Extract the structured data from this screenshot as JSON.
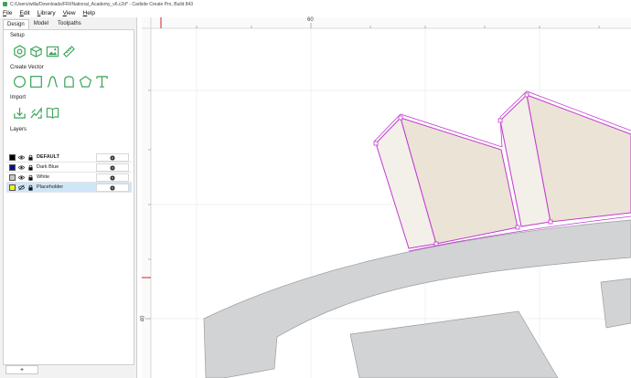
{
  "window": {
    "title": "C:/Users/willa/Downloads/FRI/National_Academy_v6.c2d* - Carbide Create Pro, Build 843"
  },
  "menu": {
    "items": [
      "File",
      "Edit",
      "Library",
      "View",
      "Help"
    ]
  },
  "tabs": [
    "Design",
    "Model",
    "Toolpaths"
  ],
  "active_tab": "Design",
  "sections": {
    "setup": "Setup",
    "create_vector": "Create Vector",
    "import": "Import",
    "layers": "Layers"
  },
  "tool_icons": {
    "setup": [
      "job-setup-icon",
      "stock-material-icon",
      "image-icon",
      "ruler-icon"
    ],
    "create_vector": [
      "circle-icon",
      "rectangle-icon",
      "curve-icon",
      "polygon-shape-icon",
      "pentagon-icon",
      "text-icon"
    ],
    "import": [
      "import-vector-icon",
      "import-bitmap-icon",
      "library-book-icon"
    ]
  },
  "layers": [
    {
      "name": "DEFAULT",
      "color": "#000000",
      "bold": true,
      "visible": true,
      "locked": true,
      "selected": false
    },
    {
      "name": "Dark Blue",
      "color": "#0a0f8a",
      "bold": false,
      "visible": true,
      "locked": true,
      "selected": false
    },
    {
      "name": "White",
      "color": "#c8c8c8",
      "bold": false,
      "visible": true,
      "locked": true,
      "selected": false
    },
    {
      "name": "Placeholder",
      "color": "#f4ef1a",
      "bold": false,
      "visible": false,
      "locked": true,
      "selected": true
    }
  ],
  "add_layer_label": "+",
  "ruler": {
    "top_label": "60",
    "left_label": "40"
  },
  "colors": {
    "accent_green": "#3aa55a",
    "selection_magenta": "#c23ad0",
    "ruler_marker": "#d62020",
    "shape_beige": "#efe8dd",
    "shape_gray": "#d1d3d5"
  }
}
